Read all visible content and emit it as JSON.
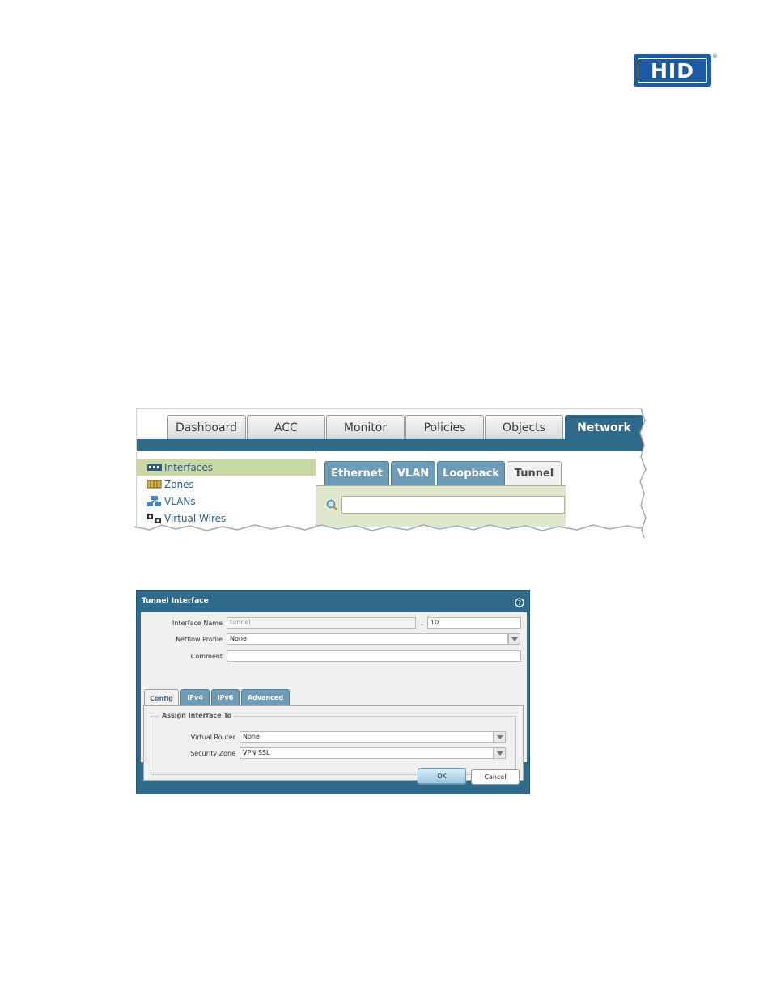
{
  "logo": {
    "text": "HID",
    "reg": "®",
    "color": "#1d5aa5"
  },
  "nav_screenshot": {
    "top_tabs": [
      {
        "label": "Dashboard",
        "active": false
      },
      {
        "label": "ACC",
        "active": false
      },
      {
        "label": "Monitor",
        "active": false
      },
      {
        "label": "Policies",
        "active": false
      },
      {
        "label": "Objects",
        "active": false
      },
      {
        "label": "Network",
        "active": true
      }
    ],
    "sidebar": [
      {
        "label": "Interfaces",
        "icon": "interfaces-icon",
        "selected": true
      },
      {
        "label": "Zones",
        "icon": "zones-icon",
        "selected": false
      },
      {
        "label": "VLANs",
        "icon": "vlans-icon",
        "selected": false
      },
      {
        "label": "Virtual Wires",
        "icon": "virtual-wires-icon",
        "selected": false
      }
    ],
    "sub_tabs": [
      {
        "label": "Ethernet",
        "active": false
      },
      {
        "label": "VLAN",
        "active": false
      },
      {
        "label": "Loopback",
        "active": false
      },
      {
        "label": "Tunnel",
        "active": true
      }
    ],
    "search": {
      "value": ""
    }
  },
  "dialog": {
    "title": "Tunnel Interface",
    "interface_name": {
      "label": "Interface Name",
      "value": "tunnel",
      "separator": ".",
      "suffix": "10"
    },
    "netflow_profile": {
      "label": "Netflow Profile",
      "value": "None"
    },
    "comment": {
      "label": "Comment",
      "value": ""
    },
    "tabs": [
      {
        "label": "Config",
        "active": true
      },
      {
        "label": "IPv4",
        "active": false
      },
      {
        "label": "IPv6",
        "active": false
      },
      {
        "label": "Advanced",
        "active": false
      }
    ],
    "assign_section": {
      "legend": "Assign Interface To",
      "virtual_router": {
        "label": "Virtual Router",
        "value": "None"
      },
      "security_zone": {
        "label": "Security Zone",
        "value": "VPN SSL"
      }
    },
    "ok_label": "OK",
    "cancel_label": "Cancel"
  },
  "colors": {
    "accent": "#2f6a8a",
    "tab_blue": "#6e9bb5",
    "selected_green": "#c9d9a6"
  }
}
